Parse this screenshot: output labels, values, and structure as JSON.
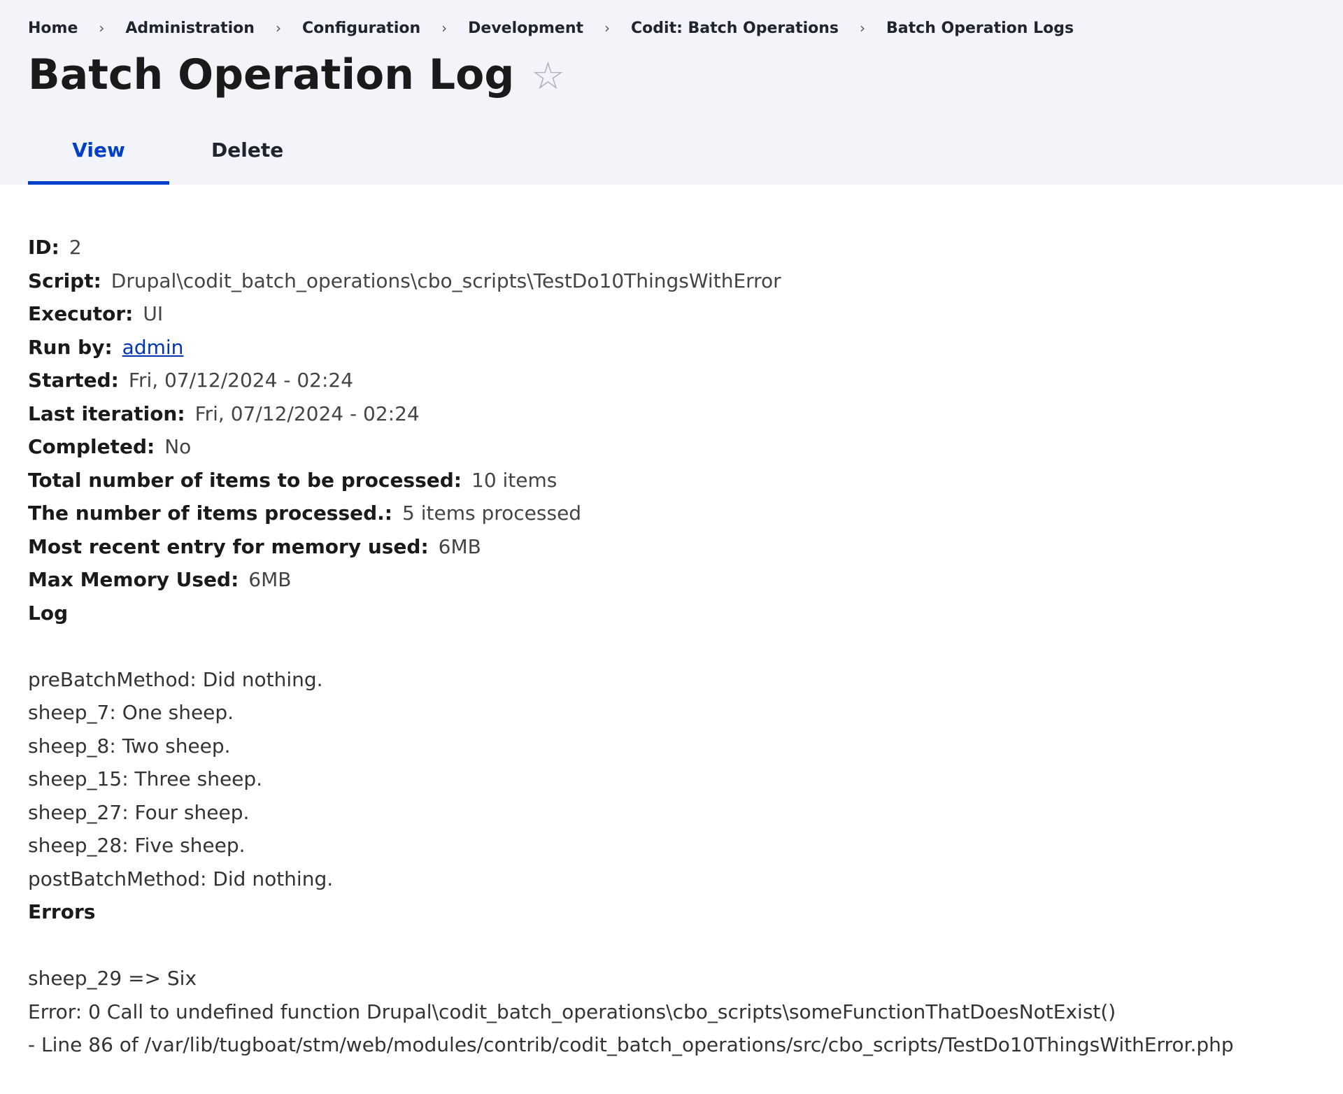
{
  "breadcrumb": {
    "items": [
      "Home",
      "Administration",
      "Configuration",
      "Development",
      "Codit: Batch Operations",
      "Batch Operation Logs"
    ],
    "separator": "›"
  },
  "page": {
    "title": "Batch Operation Log",
    "favorite_icon": "star-outline-icon"
  },
  "tabs": [
    {
      "label": "View",
      "active": true
    },
    {
      "label": "Delete",
      "active": false
    }
  ],
  "fields": {
    "id": {
      "label": "ID:",
      "value": "2"
    },
    "script": {
      "label": "Script:",
      "value": "Drupal\\codit_batch_operations\\cbo_scripts\\TestDo10ThingsWithError"
    },
    "executor": {
      "label": "Executor:",
      "value": "UI"
    },
    "run_by": {
      "label": "Run by:",
      "value": "admin"
    },
    "started": {
      "label": "Started:",
      "value": "Fri, 07/12/2024 - 02:24"
    },
    "last_iteration": {
      "label": "Last iteration:",
      "value": "Fri, 07/12/2024 - 02:24"
    },
    "completed": {
      "label": "Completed:",
      "value": "No"
    },
    "total_items": {
      "label": "Total number of items to be processed:",
      "value": "10 items"
    },
    "items_processed": {
      "label": "The number of items processed.:",
      "value": "5 items processed"
    },
    "recent_memory": {
      "label": "Most recent entry for memory used:",
      "value": "6MB"
    },
    "max_memory": {
      "label": "Max Memory Used:",
      "value": "6MB"
    }
  },
  "log": {
    "label": "Log",
    "lines": [
      "preBatchMethod: Did nothing.",
      "sheep_7: One sheep.",
      "sheep_8: Two sheep.",
      "sheep_15: Three sheep.",
      "sheep_27: Four sheep.",
      "sheep_28: Five sheep.",
      "postBatchMethod: Did nothing."
    ]
  },
  "errors": {
    "label": "Errors",
    "lines": [
      "sheep_29 => Six",
      "Error: 0 Call to undefined function Drupal\\codit_batch_operations\\cbo_scripts\\someFunctionThatDoesNotExist()",
      "- Line 86 of /var/lib/tugboat/stm/web/modules/contrib/codit_batch_operations/src/cbo_scripts/TestDo10ThingsWithError.php"
    ]
  },
  "colors": {
    "header_bg": "#f3f4f9",
    "active_tab": "#003ecc",
    "link": "#0036b1"
  }
}
